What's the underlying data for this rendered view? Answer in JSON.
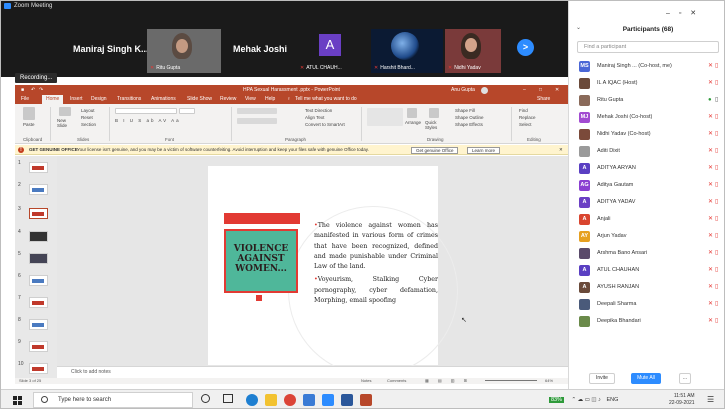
{
  "zoom": {
    "window_title": "Zoom Meeting",
    "recording_label": "Recording...",
    "video_tiles": [
      {
        "big_name": "Maniraj Singh K...",
        "caption": ""
      },
      {
        "big_name": "",
        "caption": "Ritu Gupta"
      },
      {
        "big_name": "Mehak Joshi",
        "caption": ""
      },
      {
        "big_name": "A",
        "caption": "ATUL CHAUH..."
      },
      {
        "big_name": "",
        "caption": "Harshit Bhard..."
      },
      {
        "big_name": "",
        "caption": "Nidhi Yadav"
      }
    ],
    "next_icon": "chevron-right-icon"
  },
  "ppt": {
    "title": "HPA Sexual Harassment .pptx - PowerPoint",
    "user": "Anu Gupta",
    "tabs": [
      "File",
      "Home",
      "Insert",
      "Design",
      "Transitions",
      "Animations",
      "Slide Show",
      "Review",
      "View",
      "Help",
      "Tell me what you want to do"
    ],
    "share": "Share",
    "ribbon": {
      "paste": "Paste",
      "new_slide": "New Slide",
      "layout": "Layout",
      "reset": "Reset",
      "section": "Section",
      "arrange": "Arrange",
      "quick_styles": "Quick Styles",
      "find": "Find",
      "replace": "Replace",
      "select": "Select",
      "groups": [
        "Clipboard",
        "Slides",
        "Font",
        "Paragraph",
        "Drawing",
        "Editing"
      ]
    },
    "warning": {
      "label": "GET GENUINE OFFICE",
      "text": "Your license isn't genuine, and you may be a victim of software counterfeiting. Avoid interruption and keep your files safe with genuine Office today.",
      "btn_primary": "Get genuine Office",
      "btn_secondary": "Learn more"
    },
    "slide": {
      "box_title": "VIOLENCE AGAINST WOMEN...",
      "bullet1": "The violence against women has manifested in various form of crimes that have been recognized, defined and made punishable under Criminal Law of the land.",
      "bullet2": "Voyeurism, Stalking Cyber pornography, cyber defamation, Morphing, email spoofing"
    },
    "notes_placeholder": "Click to add notes",
    "status_left": "Slide 3 of 25",
    "status_notes": "Notes",
    "status_comments": "Comments",
    "zoom_level": "64%",
    "thumb_numbers": [
      "1",
      "2",
      "3",
      "4",
      "5",
      "6",
      "7",
      "8",
      "9",
      "10"
    ]
  },
  "participants": {
    "header": "Participants (68)",
    "search_placeholder": "Find a participant",
    "list": [
      {
        "initials": "MS",
        "name": "Maniraj Singh ... (Co-host, me)",
        "color": "#4a67d6"
      },
      {
        "initials": "",
        "name": "IL A IQAC (Host)",
        "color": "#6b4a3a"
      },
      {
        "initials": "",
        "name": "Ritu Gupta",
        "color": "#8a6a5a"
      },
      {
        "initials": "MJ",
        "name": "Mehak Joshi (Co-host)",
        "color": "#a24bd1"
      },
      {
        "initials": "",
        "name": "Nidhi Yadav (Co-host)",
        "color": "#7b4a3a"
      },
      {
        "initials": "",
        "name": "Aditi Dixit",
        "color": "#9a9a9a"
      },
      {
        "initials": "A",
        "name": "ADITYA ARYAN",
        "color": "#5a3fc2"
      },
      {
        "initials": "AG",
        "name": "Aditya Gautam",
        "color": "#8a3fd1"
      },
      {
        "initials": "A",
        "name": "ADITYA YADAV",
        "color": "#6b3fc4"
      },
      {
        "initials": "A",
        "name": "Anjali",
        "color": "#d9452f"
      },
      {
        "initials": "AY",
        "name": "Arjun Yadav",
        "color": "#e6a020"
      },
      {
        "initials": "",
        "name": "Arshma Bano Ansari",
        "color": "#5a4a6a"
      },
      {
        "initials": "A",
        "name": "ATUL CHAUHAN",
        "color": "#5a3fc2"
      },
      {
        "initials": "A",
        "name": "AYUSH RANJAN",
        "color": "#6a4a3a"
      },
      {
        "initials": "",
        "name": "Deepali Sharma",
        "color": "#4a5a7a"
      },
      {
        "initials": "",
        "name": "Deepika Bhandari",
        "color": "#6a8a4a"
      }
    ],
    "invite": "Invite",
    "mute_all": "Mute All",
    "more": "..."
  },
  "taskbar": {
    "search_placeholder": "Type here to search",
    "battery": "83%",
    "lang": "ENG",
    "time": "11:51 AM",
    "date": "22-09-2021"
  }
}
